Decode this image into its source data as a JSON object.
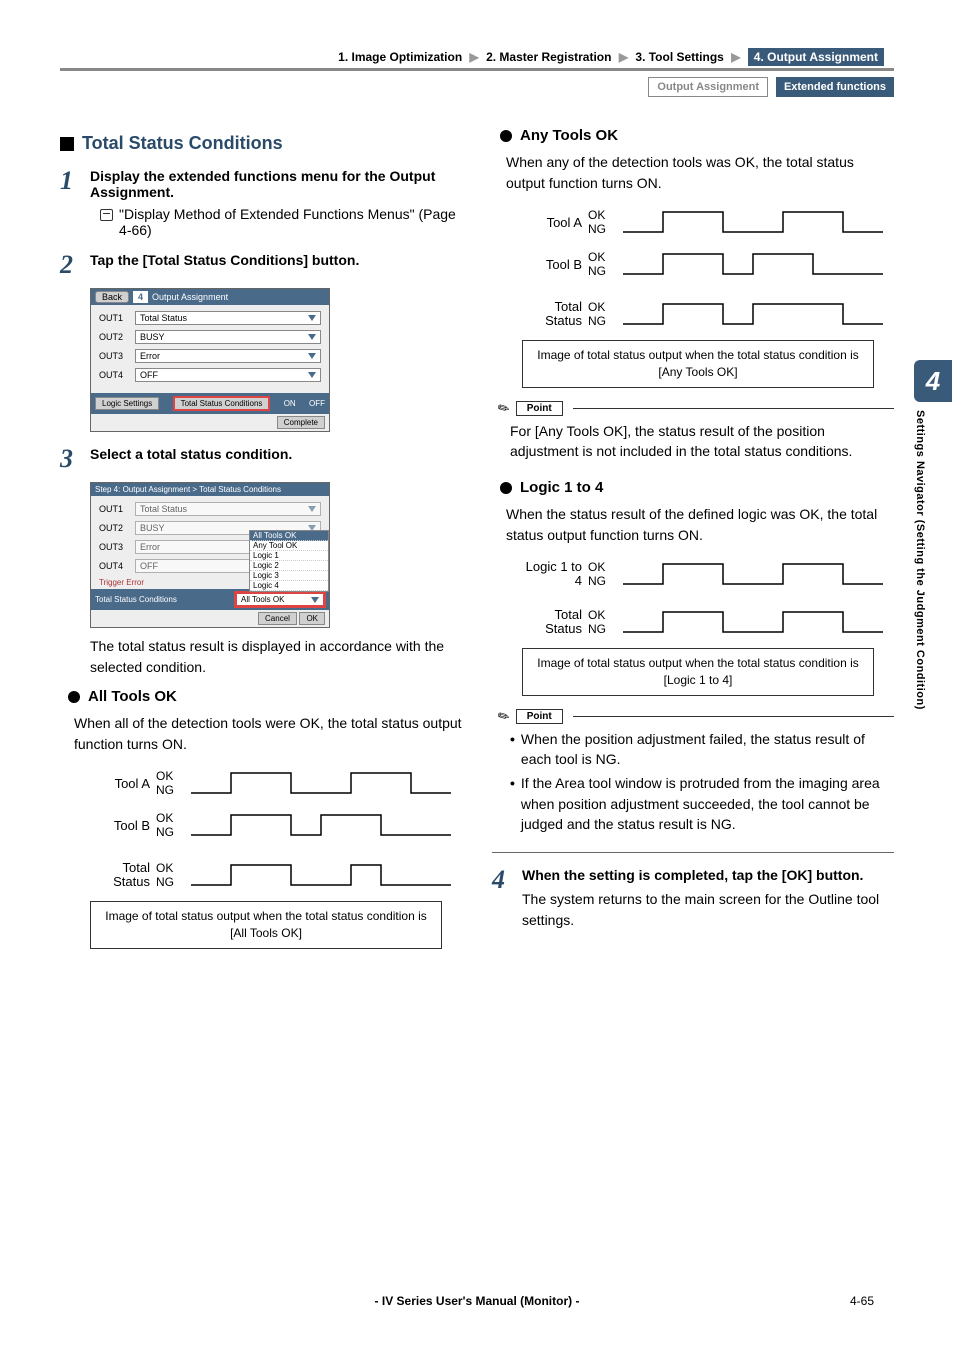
{
  "breadcrumb": {
    "items": [
      "1. Image Optimization",
      "2. Master Registration",
      "3. Tool Settings",
      "4. Output Assignment"
    ]
  },
  "tags": {
    "outline": "Output Assignment",
    "fill": "Extended functions"
  },
  "side": {
    "num": "4",
    "text": "Settings Navigator (Setting the Judgment Condition)"
  },
  "left": {
    "section_title": "Total Status Conditions",
    "step1": {
      "title": "Display the extended functions menu for the Output Assignment.",
      "ref": "\"Display Method of Extended Functions Menus\" (Page 4-66)"
    },
    "step2": {
      "title": "Tap the [Total Status Conditions] button."
    },
    "ss1": {
      "back": "Back",
      "head_num": "4",
      "head": "Output Assignment",
      "rows": [
        {
          "k": "OUT1",
          "v": "Total Status"
        },
        {
          "k": "OUT2",
          "v": "BUSY"
        },
        {
          "k": "OUT3",
          "v": "Error"
        },
        {
          "k": "OUT4",
          "v": "OFF"
        }
      ],
      "foot_l": "Logic Settings",
      "foot_c": "Total Status Conditions",
      "foot_r1": "ON",
      "foot_r2": "OFF",
      "complete": "Complete"
    },
    "step3": {
      "title": "Select a total status condition."
    },
    "ss2": {
      "head": "Step 4: Output Assignment > Total Status Conditions",
      "rows": [
        {
          "k": "OUT1",
          "v": "Total Status"
        },
        {
          "k": "OUT2",
          "v": "BUSY"
        },
        {
          "k": "OUT3",
          "v": "Error"
        },
        {
          "k": "OUT4",
          "v": "OFF"
        }
      ],
      "opts": [
        "All Tools OK",
        "Any Tool OK",
        "Logic 1",
        "Logic 2",
        "Logic 3",
        "Logic 4"
      ],
      "trig": "Trigger Error",
      "bar": "Total Status Conditions",
      "sel": "All Tools OK",
      "cancel": "Cancel",
      "ok": "OK"
    },
    "step3_note": "The total status result is displayed in accordance with the selected condition.",
    "all_tools": {
      "title": "All Tools OK",
      "desc": "When all of the detection tools were OK, the total status output function turns ON.",
      "labels": {
        "a": "Tool A",
        "b": "Tool B",
        "total": "Total Status",
        "ok": "OK",
        "ng": "NG"
      },
      "caption": "Image of total status output when the total status condition is [All Tools OK]"
    }
  },
  "right": {
    "any_tools": {
      "title": "Any Tools OK",
      "desc": "When any of the detection tools was OK, the total status output function turns ON.",
      "labels": {
        "a": "Tool A",
        "b": "Tool B",
        "total": "Total Status",
        "ok": "OK",
        "ng": "NG"
      },
      "caption": "Image of total status output when the total status condition is [Any Tools OK]"
    },
    "point1": {
      "label": "Point",
      "body": "For [Any Tools OK], the status result of the position adjustment is not included in the total status conditions."
    },
    "logic": {
      "title": "Logic 1 to 4",
      "desc": "When the status result of the defined logic was OK, the total status output function turns ON.",
      "labels": {
        "logic": "Logic 1 to 4",
        "total": "Total Status",
        "ok": "OK",
        "ng": "NG"
      },
      "caption": "Image of total status output when the total status condition is [Logic 1 to 4]"
    },
    "point2": {
      "label": "Point",
      "items": [
        "When the position adjustment failed, the status result of each tool is NG.",
        "If the Area tool window is protruded from the imaging area when position adjustment succeeded, the tool cannot be judged and the status result is NG."
      ]
    },
    "step4": {
      "title": "When the setting is completed, tap the [OK] button.",
      "note": "The system returns to the main screen for the Outline tool settings."
    }
  },
  "footer": {
    "center": "- IV Series User's Manual (Monitor) -",
    "page": "4-65"
  }
}
